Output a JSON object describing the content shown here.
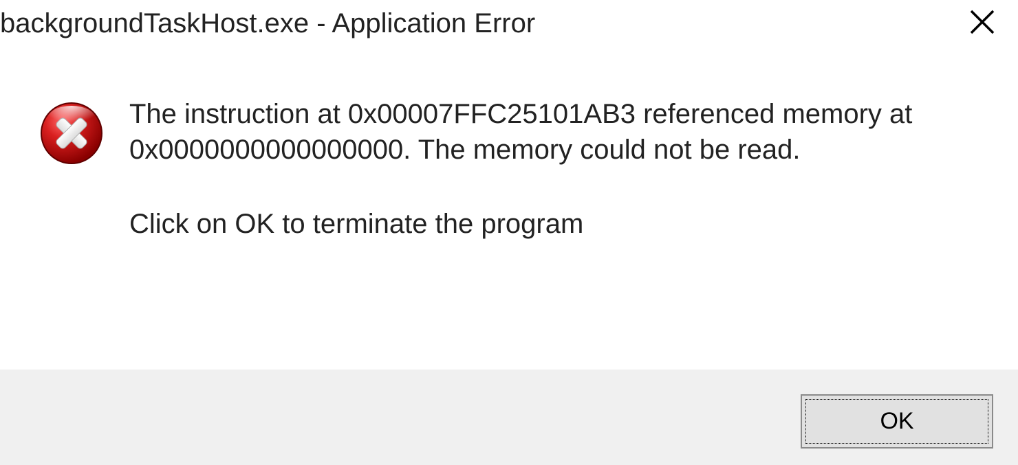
{
  "dialog": {
    "title": "backgroundTaskHost.exe - Application Error",
    "message_line1": "The instruction at 0x00007FFC25101AB3 referenced memory at 0x0000000000000000. The memory could not be read.",
    "message_line2": "Click on OK to terminate the program",
    "ok_label": "OK"
  }
}
